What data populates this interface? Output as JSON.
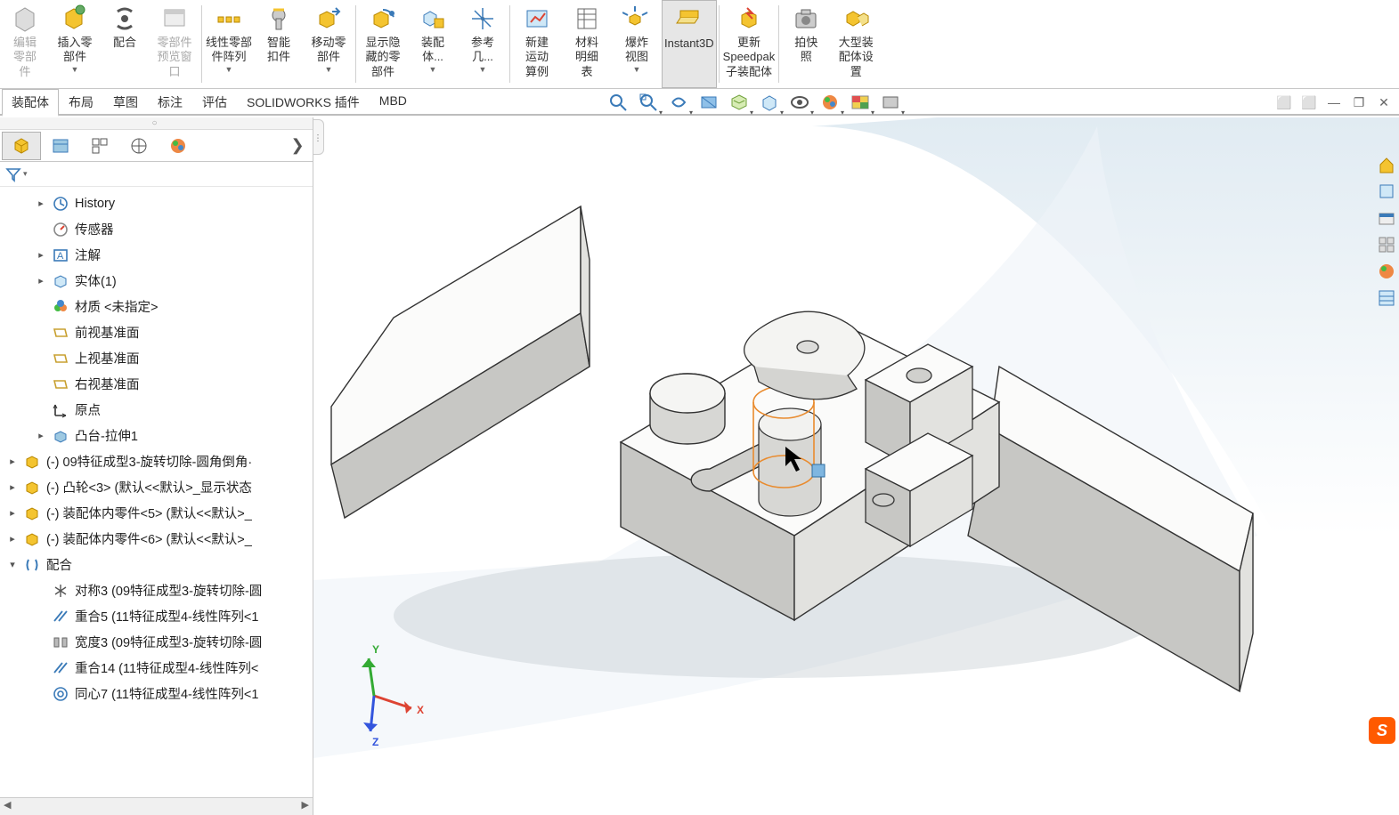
{
  "ribbon": {
    "items": [
      {
        "label": "编辑\n零部\n件",
        "disabled": true,
        "icon": "edit-component"
      },
      {
        "label": "插入零\n部件",
        "icon": "insert-component",
        "dd": true
      },
      {
        "label": "配合",
        "icon": "mate"
      },
      {
        "label": "零部件\n预览窗\n口",
        "disabled": true,
        "icon": "preview-window"
      },
      {
        "sep": true
      },
      {
        "label": "线性零部\n件阵列",
        "icon": "linear-pattern",
        "dd": true
      },
      {
        "label": "智能\n扣件",
        "icon": "smart-fastener"
      },
      {
        "label": "移动零\n部件",
        "icon": "move-component",
        "dd": true
      },
      {
        "sep": true
      },
      {
        "label": "显示隐\n藏的零\n部件",
        "icon": "show-hidden"
      },
      {
        "label": "装配\n体...",
        "icon": "assembly-features",
        "dd": true
      },
      {
        "label": "参考\n几...",
        "icon": "ref-geometry",
        "dd": true
      },
      {
        "sep": true
      },
      {
        "label": "新建\n运动\n算例",
        "icon": "motion-study"
      },
      {
        "label": "材料\n明细\n表",
        "icon": "bom"
      },
      {
        "label": "爆炸\n视图",
        "icon": "exploded-view",
        "dd": true
      },
      {
        "label": "Instant3D",
        "icon": "instant3d",
        "active": true
      },
      {
        "sep": true
      },
      {
        "label": "更新\nSpeedpak\n子装配体",
        "icon": "speedpak"
      },
      {
        "sep": true
      },
      {
        "label": "拍快\n照",
        "icon": "snapshot"
      },
      {
        "label": "大型装\n配体设\n置",
        "icon": "large-assembly"
      }
    ]
  },
  "tabs": [
    "装配体",
    "布局",
    "草图",
    "标注",
    "评估",
    "SOLIDWORKS 插件",
    "MBD"
  ],
  "active_tab": 0,
  "tree": [
    {
      "arrow": "▸",
      "icon": "history",
      "label": "History",
      "indent": 1
    },
    {
      "arrow": "",
      "icon": "sensor",
      "label": "传感器",
      "indent": 1
    },
    {
      "arrow": "▸",
      "icon": "annotations",
      "label": "注解",
      "indent": 1
    },
    {
      "arrow": "▸",
      "icon": "solidbody",
      "label": "实体(1)",
      "indent": 1
    },
    {
      "arrow": "",
      "icon": "material",
      "label": "材质 <未指定>",
      "indent": 1
    },
    {
      "arrow": "",
      "icon": "plane",
      "label": "前视基准面",
      "indent": 1
    },
    {
      "arrow": "",
      "icon": "plane",
      "label": "上视基准面",
      "indent": 1
    },
    {
      "arrow": "",
      "icon": "plane",
      "label": "右视基准面",
      "indent": 1
    },
    {
      "arrow": "",
      "icon": "origin",
      "label": "原点",
      "indent": 1
    },
    {
      "arrow": "▸",
      "icon": "extrude",
      "label": "凸台-拉伸1",
      "indent": 1
    },
    {
      "arrow": "▸",
      "icon": "part",
      "label": "(-) 09特征成型3-旋转切除-圆角倒角·",
      "indent": 0
    },
    {
      "arrow": "▸",
      "icon": "part",
      "label": "(-) 凸轮<3> (默认<<默认>_显示状态",
      "indent": 0
    },
    {
      "arrow": "▸",
      "icon": "part",
      "label": "(-) 装配体内零件<5> (默认<<默认>_",
      "indent": 0
    },
    {
      "arrow": "▸",
      "icon": "part",
      "label": "(-) 装配体内零件<6> (默认<<默认>_",
      "indent": 0
    },
    {
      "arrow": "▾",
      "icon": "mates",
      "label": "配合",
      "indent": 0
    },
    {
      "arrow": "",
      "icon": "symmetric",
      "label": "对称3 (09特征成型3-旋转切除-圆",
      "indent": 1
    },
    {
      "arrow": "",
      "icon": "coincident",
      "label": "重合5 (11特征成型4-线性阵列<1",
      "indent": 1
    },
    {
      "arrow": "",
      "icon": "width",
      "label": "宽度3 (09特征成型3-旋转切除-圆",
      "indent": 1
    },
    {
      "arrow": "",
      "icon": "coincident",
      "label": "重合14 (11特征成型4-线性阵列<",
      "indent": 1
    },
    {
      "arrow": "",
      "icon": "concentric",
      "label": "同心7 (11特征成型4-线性阵列<1",
      "indent": 1
    }
  ],
  "triad": {
    "x": "X",
    "y": "Y",
    "z": "Z"
  },
  "sogou": "S",
  "tree_scroll_caret": "⌃"
}
